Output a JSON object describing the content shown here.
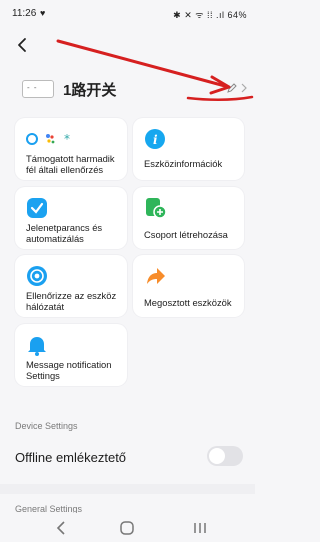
{
  "status_bar": {
    "time": "11:26",
    "notification_dot": "♥",
    "right_icons": "✱ ✕ ᯤ ⁞⁞ .ıl 64%"
  },
  "header": {
    "back_icon": "arrow-left-icon",
    "device_badge": "- -",
    "device_name": "1路开关"
  },
  "tiles": [
    {
      "label": "Támogatott harmadik fél általi ellenőrzés",
      "icon": "smart-assistants-icon",
      "accent": "#1aa0f0"
    },
    {
      "label": "Eszközinformációk",
      "icon": "info-icon",
      "accent": "#16a7ef"
    },
    {
      "label": "Jelenetparancs és automatizálás",
      "icon": "automation-icon",
      "accent": "#1ba2f0"
    },
    {
      "label": "Csoport létrehozása",
      "icon": "group-add-icon",
      "accent": "#2fb55a"
    },
    {
      "label": "Ellenőrizze az eszköz hálózatát",
      "icon": "network-check-icon",
      "accent": "#1aa0f0"
    },
    {
      "label": "Megosztott eszközök",
      "icon": "share-icon",
      "accent": "#f78c2a"
    },
    {
      "label": "Message notification Settings",
      "icon": "bell-icon",
      "accent": "#1aa0f0"
    }
  ],
  "device_settings": {
    "section_title": "Device Settings",
    "offline_reminder_label": "Offline emlékeztető",
    "offline_reminder_on": false
  },
  "general_settings": {
    "section_title": "General Settings"
  },
  "nav_bar": {
    "back": "<",
    "home": "○",
    "recents": "|||"
  }
}
